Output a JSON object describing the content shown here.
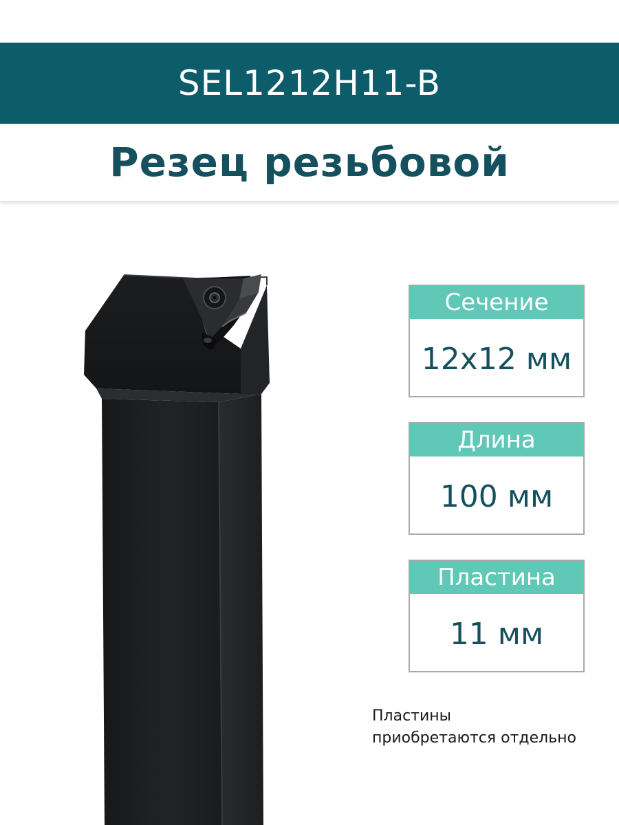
{
  "header": {
    "model": "SEL1212H11-B",
    "title": "Резец резьбовой"
  },
  "specs": [
    {
      "label": "Сечение",
      "value": "12x12 мм"
    },
    {
      "label": "Длина",
      "value": "100 мм"
    },
    {
      "label": "Пластина",
      "value": "11 мм"
    }
  ],
  "note": {
    "line1": "Пластины",
    "line2": "приобретаются отдельно"
  },
  "colors": {
    "banner": "#0c5c6a",
    "title_text": "#14505d",
    "label_bg": "#5fc8b6",
    "card_border": "#a9a9a9",
    "tool_body": "#1b1c1e"
  },
  "icons": {
    "product": "threading-tool-holder-image",
    "screw": "torx-screw-icon"
  }
}
